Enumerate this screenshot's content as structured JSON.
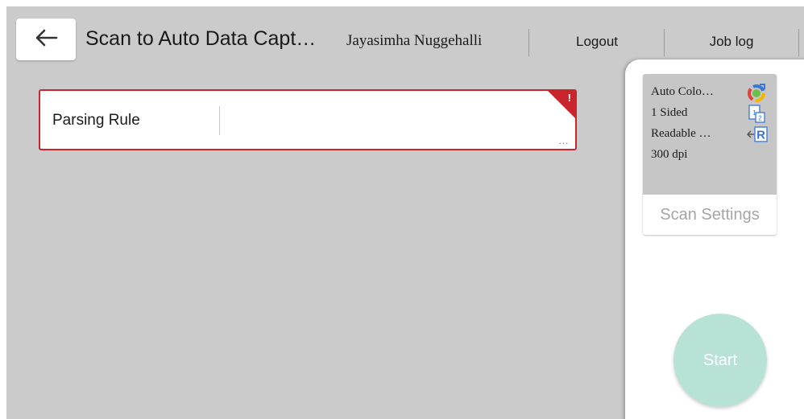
{
  "header": {
    "title": "Scan to Auto Data Capt…",
    "user_name": "Jayasimha Nuggehalli",
    "logout_label": "Logout",
    "job_log_label": "Job log"
  },
  "form": {
    "parsing_rule_label": "Parsing Rule",
    "parsing_rule_value": "",
    "error_indicator": "!",
    "more_indicator": "…"
  },
  "scan_settings": {
    "color_mode": "Auto Colo…",
    "color_mode_icon": "auto-color-icon",
    "sides": "1 Sided",
    "sides_icon": "single-sided-icon",
    "orientation": "Readable …",
    "orientation_icon": "readable-direction-icon",
    "resolution": "300 dpi",
    "button_label": "Scan Settings"
  },
  "start_label": "Start",
  "colors": {
    "error": "#c8262c",
    "start_button": "#b9e2d7",
    "background": "#cbcbcb",
    "icon_blue": "#3a76d8"
  }
}
